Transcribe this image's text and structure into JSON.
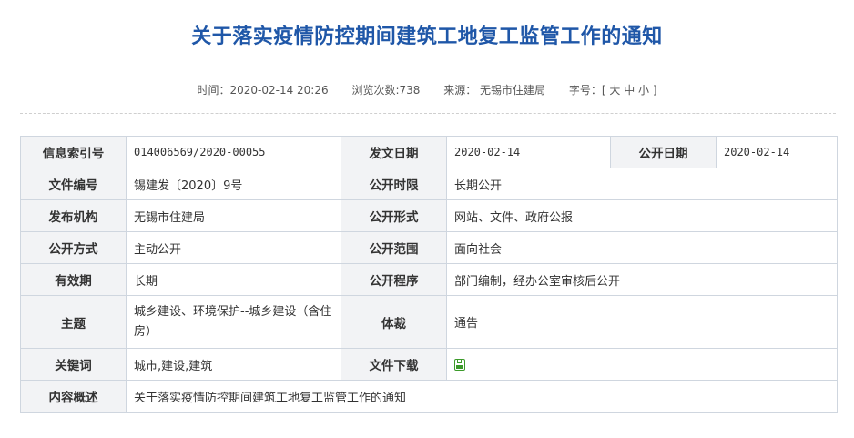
{
  "title": "关于落实疫情防控期间建筑工地复工监管工作的通知",
  "meta": {
    "time": "时间：2020-02-14 20:26",
    "views": "浏览次数:738",
    "source": "来源： 无锡市住建局",
    "fontsize": "字号：[ 大 中 小 ]"
  },
  "table": {
    "index_label": "信息索引号",
    "index_value": "014006569/2020-00055",
    "issue_date_label": "发文日期",
    "issue_date_value": "2020-02-14",
    "public_date_label": "公开日期",
    "public_date_value": "2020-02-14",
    "doc_no_label": "文件编号",
    "doc_no_value": "锡建发〔2020〕9号",
    "public_time_label": "公开时限",
    "public_time_value": "长期公开",
    "org_label": "发布机构",
    "org_value": "无锡市住建局",
    "public_form_label": "公开形式",
    "public_form_value": "网站、文件、政府公报",
    "public_way_label": "公开方式",
    "public_way_value": "主动公开",
    "public_scope_label": "公开范围",
    "public_scope_value": "面向社会",
    "validity_label": "有效期",
    "validity_value": "长期",
    "procedure_label": "公开程序",
    "procedure_value": "部门编制，经办公室审核后公开",
    "topic_label": "主题",
    "topic_value": "城乡建设、环境保护--城乡建设（含住房）",
    "genre_label": "体裁",
    "genre_value": "通告",
    "keywords_label": "关键词",
    "keywords_value": "城市,建设,建筑",
    "download_label": "文件下载",
    "summary_label": "内容概述",
    "summary_value": "关于落实疫情防控期间建筑工地复工监管工作的通知"
  },
  "icons": {
    "download": "save-icon"
  },
  "colors": {
    "title": "#1f57a8",
    "label_bg": "#f2f3f5",
    "border": "#cfd6df",
    "icon": "#3c9a2a"
  }
}
